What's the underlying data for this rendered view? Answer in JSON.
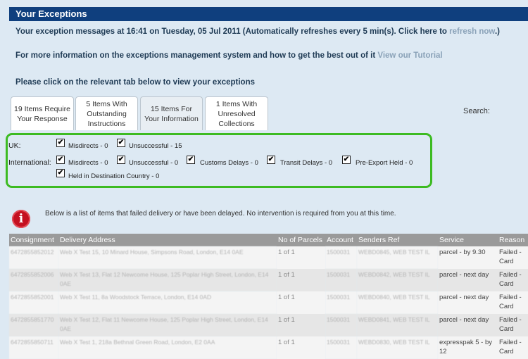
{
  "header": {
    "title": "Your Exceptions"
  },
  "messages": {
    "refresh_prefix": "Your exception messages at 16:41 on Tuesday, 05 Jul 2011 (Automatically refreshes every 5 min(s). Click here to",
    "refresh_link": "refresh now",
    "refresh_suffix": ".)",
    "info_prefix": "For more information on the exceptions management system and how to get the best out of it",
    "tutorial_link": "View our Tutorial",
    "tab_prompt": "Please click on the relevant tab below to view your exceptions"
  },
  "tabs": [
    {
      "label": "19 Items Require Your Response"
    },
    {
      "label": "5 Items With Outstanding Instructions"
    },
    {
      "label": "15 Items For Your Information"
    },
    {
      "label": "1 Items With Unresolved Collections"
    }
  ],
  "search": {
    "label": "Search:"
  },
  "filters": {
    "uk_label": "UK:",
    "international_label": "International:",
    "uk": [
      {
        "label": "Misdirects - 0",
        "checked": true
      },
      {
        "label": "Unsuccessful - 15",
        "checked": true
      }
    ],
    "international": [
      {
        "label": "Misdirects - 0",
        "checked": true
      },
      {
        "label": "Unsuccessful - 0",
        "checked": true
      },
      {
        "label": "Customs Delays - 0",
        "checked": true
      },
      {
        "label": "Transit Delays - 0",
        "checked": true
      },
      {
        "label": "Pre-Export Held - 0",
        "checked": true
      },
      {
        "label": "Held in Destination Country - 0",
        "checked": true
      }
    ],
    "check_glyph": "✔"
  },
  "notice": {
    "icon": "info-icon",
    "icon_glyph": "i",
    "text": "Below is a list of items that failed delivery or have been delayed. No intervention is required from you at this time."
  },
  "table": {
    "headers": [
      "Consignment",
      "Delivery Address",
      "No of Parcels",
      "Account",
      "Senders Ref",
      "Service",
      "Reason"
    ],
    "rows": [
      {
        "consignment": "6472855852012",
        "address": "Web X Test 15, 10 Minard House, Simpsons Road, London, E14 0AE",
        "parcels": "1 of 1",
        "account": "1500031",
        "ref": "WEBD0845, WEB TEST IL",
        "service": "parcel - by 9.30",
        "reason": "Failed - Card"
      },
      {
        "consignment": "6472855852006",
        "address": "Web X Test 13, Flat 12 Newcome House, 125 Poplar High Street, London, E14 0AE",
        "parcels": "1 of 1",
        "account": "1500031",
        "ref": "WEBD0842, WEB TEST IL",
        "service": "parcel - next day",
        "reason": "Failed - Card"
      },
      {
        "consignment": "6472855852001",
        "address": "Web X Test 11, 8a Woodstock Terrace, London, E14 0AD",
        "parcels": "1 of 1",
        "account": "1500031",
        "ref": "WEBD0840, WEB TEST IL",
        "service": "parcel - next day",
        "reason": "Failed - Card"
      },
      {
        "consignment": "6472855851770",
        "address": "Web X Test 12, Flat 11 Newcome House, 125 Poplar High Street, London, E14 0AE",
        "parcels": "1 of 1",
        "account": "1500031",
        "ref": "WEBD0841, WEB TEST IL",
        "service": "parcel - next day",
        "reason": "Failed - Card"
      },
      {
        "consignment": "6472855850711",
        "address": "Web X Test 1, 218a Bethnal Green Road, London, E2 0AA",
        "parcels": "1 of 1",
        "account": "1500031",
        "ref": "WEBD0830, WEB TEST IL",
        "service": "expresspak 5 - by 12",
        "reason": "Failed - Card"
      }
    ]
  }
}
